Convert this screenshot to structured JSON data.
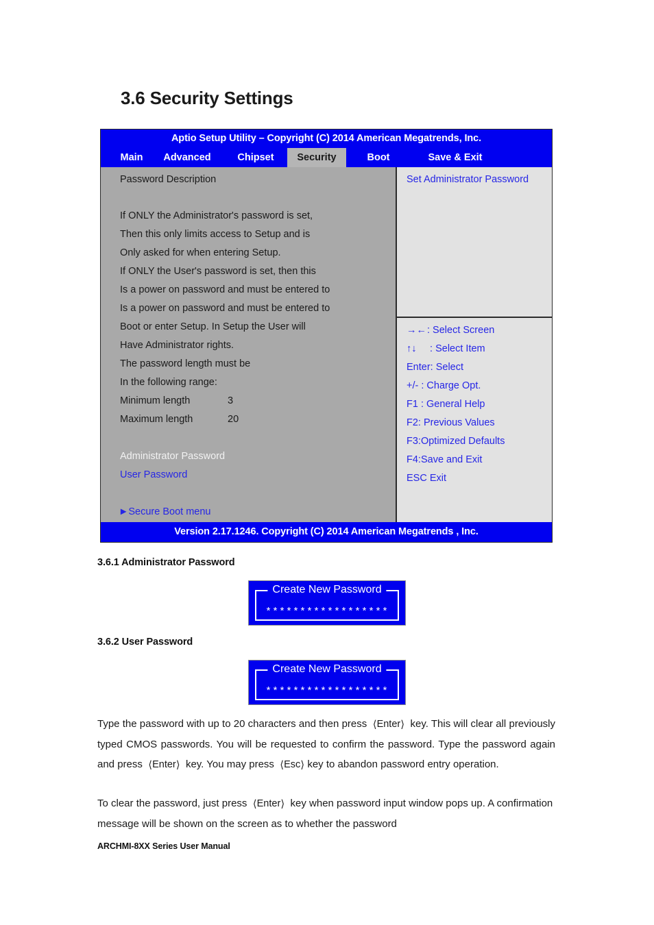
{
  "document": {
    "section_heading": "3.6 Security Settings",
    "subsection_admin": "3.6.1 Administrator Password",
    "subsection_user": "3.6.2 User Password",
    "footer": "ARCHMI-8XX Series User Manual",
    "paragraph_1": {
      "line1_a": "Type the password with up to 20 characters and then press",
      "key1": "Enter",
      "line1_b": "key. This will",
      "line2": "clear all previously typed CMOS passwords. You will be requested to confirm the",
      "line3_a": "password. Type the password again and press",
      "key2": "Enter",
      "line3_b": "key. You may press",
      "key3": "Esc",
      "line4": "key to abandon password entry operation."
    },
    "paragraph_2": {
      "line1_a": "To clear the password, just press",
      "key1": "Enter",
      "line1_b": "key when password input window pops",
      "line2": "up. A confirmation message will be shown on the screen as to whether the password"
    }
  },
  "bios": {
    "titlebar": "Aptio Setup Utility – Copyright (C) 2014 American Megatrends, Inc.",
    "footer": "Version 2.17.1246. Copyright (C) 2014 American Megatrends , Inc.",
    "tabs": [
      {
        "label": "Main",
        "active": false
      },
      {
        "label": "Advanced",
        "active": false
      },
      {
        "label": "Chipset",
        "active": false
      },
      {
        "label": "Security",
        "active": true
      },
      {
        "label": "Boot",
        "active": false
      },
      {
        "label": "Save & Exit",
        "active": false
      }
    ],
    "left_panel": {
      "heading": "Password Description",
      "description_lines": [
        "If ONLY the Administrator's password is set,",
        "Then this only limits access to Setup and is",
        "Only asked for when entering Setup.",
        "If ONLY the User's password is set, then this",
        "Is a power on password and must be entered to",
        "Is a power on password and must be entered to",
        "Boot or enter Setup. In Setup the User will",
        "Have Administrator rights.",
        "The password length must be",
        "In the following range:"
      ],
      "min_length_label": "Minimum length",
      "min_length_value": "3",
      "max_length_label": "Maximum length",
      "max_length_value": "20",
      "admin_password_item": "Administrator Password",
      "user_password_item": "User Password",
      "secure_boot_item": "Secure Boot menu",
      "secure_boot_arrow": "►"
    },
    "right_panel": {
      "help_title": "Set Administrator Password",
      "keys": [
        {
          "glyph": "→←",
          "label": ": Select Screen"
        },
        {
          "glyph": "↑↓",
          "label": " : Select Item"
        },
        {
          "glyph": "Enter:",
          "label": "  Select"
        },
        {
          "glyph": "+/-",
          "label": " : Charge Opt."
        },
        {
          "glyph": "F1",
          "label": " : General Help"
        },
        {
          "glyph": "F2:",
          "label": " Previous Values"
        },
        {
          "glyph": "F3:",
          "label": "Optimized Defaults"
        },
        {
          "glyph": "F4:",
          "label": "Save and Exit"
        },
        {
          "glyph": "ESC",
          "label": "   Exit"
        }
      ]
    }
  },
  "dialogs": {
    "admin": {
      "title": "Create New Password",
      "value": "******************"
    },
    "user": {
      "title": "Create New Password",
      "value": "******************"
    }
  }
}
